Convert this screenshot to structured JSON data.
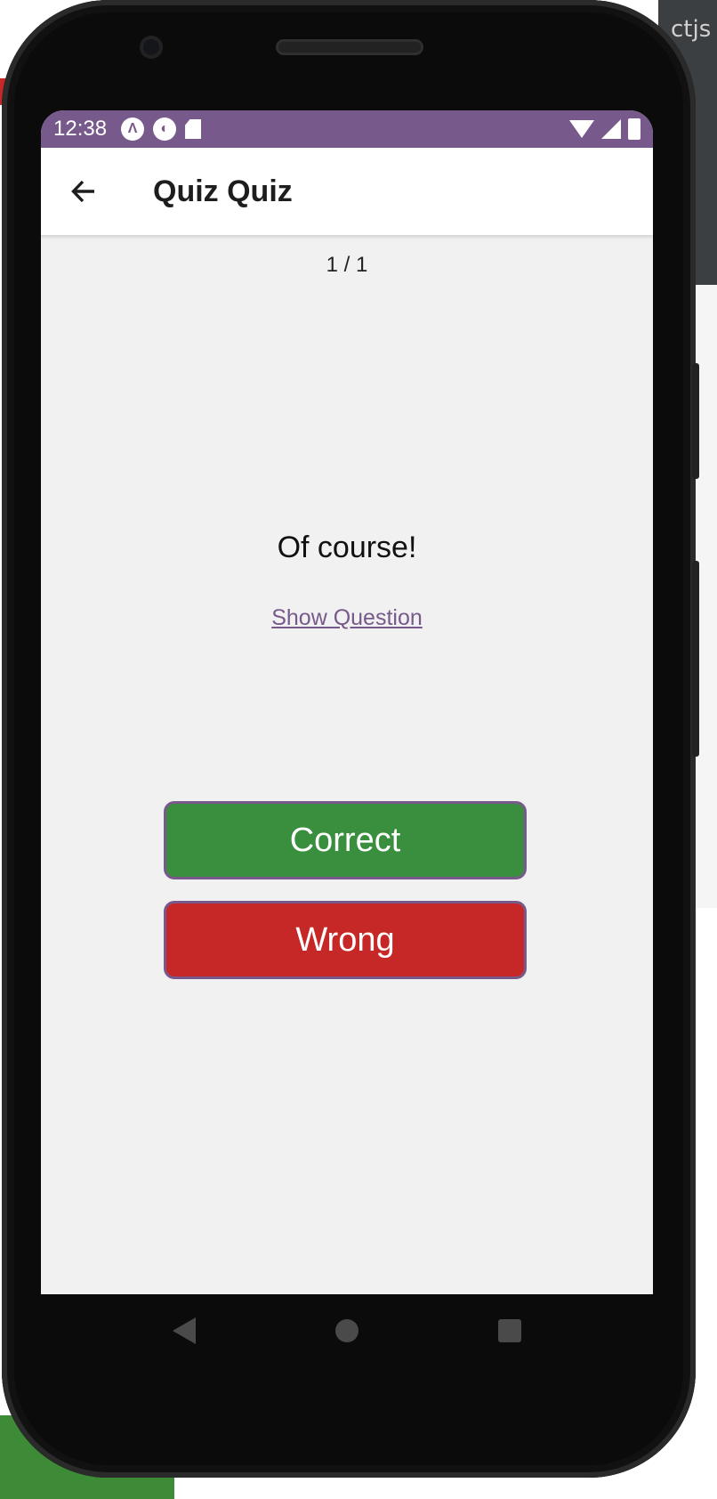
{
  "background": {
    "text_fragment": "ctjs"
  },
  "status_bar": {
    "time": "12:38",
    "color": "#775a8b",
    "left_icons": [
      "android-app-icon",
      "app-notification-icon",
      "sd-card-icon"
    ],
    "right_icons": [
      "wifi-icon",
      "signal-icon",
      "battery-icon"
    ]
  },
  "app_bar": {
    "title": "Quiz Quiz",
    "back_icon": "arrow-left-icon"
  },
  "quiz": {
    "counter": "1 / 1",
    "card_text": "Of course!",
    "toggle_link": "Show Question",
    "correct_label": "Correct",
    "wrong_label": "Wrong",
    "correct_color": "#3a8f3e",
    "wrong_color": "#c62828"
  },
  "nav_bar": {
    "icons": [
      "nav-back-icon",
      "nav-home-icon",
      "nav-recents-icon"
    ]
  }
}
